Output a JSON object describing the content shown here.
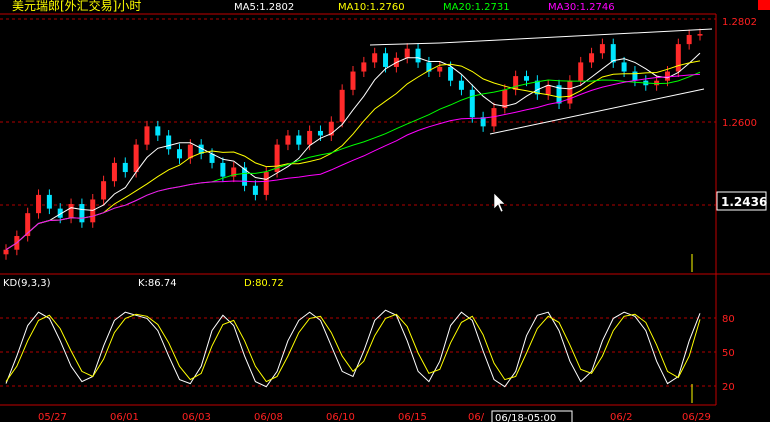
{
  "colors": {
    "background": "#000000",
    "up_candle": "#ff2a2a",
    "down_candle": "#00e5ff",
    "ma5": "#ffffff",
    "ma10": "#ffff00",
    "ma20": "#00ff00",
    "ma30": "#ff00ff",
    "grid": "#b00000",
    "title": "#ffff00",
    "kd_k": "#ffffff",
    "kd_d": "#ffff00"
  },
  "header": {
    "title": "美元瑞郎[外汇交易]小时",
    "ma5": "MA5:1.2802",
    "ma10": "MA10:1.2760",
    "ma20": "MA20:1.2731",
    "ma30": "MA30:1.2746"
  },
  "price_axis": {
    "top_label": "1.2802",
    "mid_label": "1.2600",
    "last_label": "1.2436"
  },
  "kd_header": {
    "name": "KD(9,3,3)",
    "k": "K:86.74",
    "d": "D:80.72"
  },
  "kd_axis": [
    "80",
    "50",
    "20"
  ],
  "date_labels": [
    "05/27",
    "06/01",
    "06/03",
    "06/08",
    "06/10",
    "06/15",
    "06/",
    "06/18-05:00",
    "06/2",
    "06/29"
  ],
  "chart_data": [
    {
      "type": "candlestick",
      "title": "美元瑞郎[外汇交易]小时",
      "ylim": [
        1.229,
        1.2835
      ],
      "y_ticks": [
        1.2802,
        1.26,
        1.2436
      ],
      "series": [
        {
          "name": "MA5",
          "last": 1.2802
        },
        {
          "name": "MA10",
          "last": 1.276
        },
        {
          "name": "MA20",
          "last": 1.2731
        },
        {
          "name": "MA30",
          "last": 1.2746
        }
      ],
      "closes": [
        1.233,
        1.236,
        1.241,
        1.245,
        1.242,
        1.24,
        1.243,
        1.239,
        1.244,
        1.248,
        1.252,
        1.25,
        1.256,
        1.26,
        1.258,
        1.255,
        1.253,
        1.256,
        1.254,
        1.252,
        1.249,
        1.251,
        1.247,
        1.245,
        1.25,
        1.256,
        1.258,
        1.256,
        1.259,
        1.258,
        1.261,
        1.268,
        1.272,
        1.274,
        1.276,
        1.273,
        1.275,
        1.277,
        1.274,
        1.272,
        1.273,
        1.27,
        1.268,
        1.262,
        1.26,
        1.264,
        1.268,
        1.271,
        1.27,
        1.267,
        1.269,
        1.265,
        1.27,
        1.274,
        1.276,
        1.278,
        1.274,
        1.272,
        1.27,
        1.269,
        1.27,
        1.272,
        1.278,
        1.28,
        1.2802
      ]
    },
    {
      "type": "line",
      "title": "KD(9,3,3)",
      "ylim": [
        0,
        100
      ],
      "y_ticks": [
        80,
        50,
        20
      ],
      "series": [
        {
          "name": "K",
          "last": 86.74,
          "values": [
            18,
            45,
            75,
            88,
            82,
            60,
            35,
            20,
            25,
            55,
            80,
            88,
            85,
            82,
            70,
            45,
            22,
            18,
            35,
            70,
            85,
            75,
            45,
            20,
            15,
            30,
            60,
            80,
            88,
            80,
            55,
            30,
            25,
            50,
            80,
            90,
            85,
            60,
            30,
            20,
            40,
            75,
            88,
            80,
            50,
            22,
            15,
            30,
            65,
            85,
            88,
            70,
            40,
            20,
            30,
            60,
            82,
            88,
            84,
            70,
            40,
            18,
            25,
            60,
            87
          ]
        },
        {
          "name": "D",
          "last": 80.72,
          "values": [
            20,
            35,
            60,
            80,
            85,
            72,
            50,
            30,
            25,
            42,
            68,
            82,
            86,
            84,
            76,
            58,
            35,
            22,
            28,
            55,
            76,
            80,
            60,
            35,
            20,
            25,
            45,
            68,
            82,
            84,
            68,
            45,
            30,
            40,
            65,
            82,
            86,
            74,
            48,
            28,
            32,
            58,
            78,
            84,
            66,
            38,
            22,
            25,
            48,
            72,
            84,
            78,
            56,
            32,
            28,
            45,
            70,
            84,
            86,
            78,
            56,
            30,
            24,
            45,
            81
          ]
        }
      ]
    }
  ]
}
